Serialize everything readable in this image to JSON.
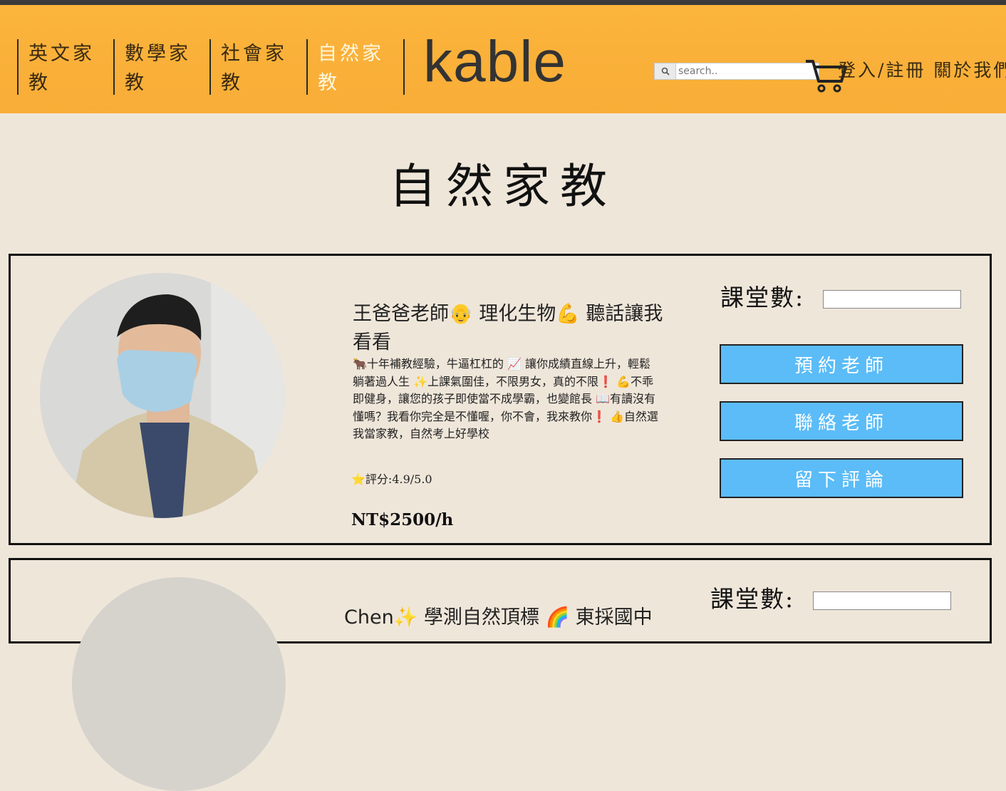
{
  "nav": {
    "items": [
      {
        "label": "英文家教",
        "active": false
      },
      {
        "label": "數學家教",
        "active": false
      },
      {
        "label": "社會家教",
        "active": false
      },
      {
        "label": "自然家教",
        "active": true
      }
    ],
    "brand": "kable",
    "search_placeholder": "search..",
    "right_text": "登入/註冊 關於我們"
  },
  "page": {
    "title": "自然家教"
  },
  "teachers": [
    {
      "name": "王爸爸老師👴 理化生物💪 聽話讓我看看",
      "description": "🐂十年補教經驗，牛逼杠杠的 📈 讓你成績直線上升，輕鬆躺著過人生 ✨上課氣圍佳，不限男女，真的不限❗ 💪不乖即健身，讓您的孩子即使當不成學霸，也變館長 📖有讀沒有懂嗎？我看你完全是不懂喔，你不會，我來教你❗ 👍自然選我當家教，自然考上好學校",
      "rating": "⭐評分:4.9/5.0",
      "price": "NT$2500/h",
      "lesson_label": "課堂數:",
      "buttons": {
        "book": "預約老師",
        "contact": "聯絡老師",
        "review": "留下評論"
      }
    },
    {
      "name": "Chen✨ 學測自然頂標 🌈 東採國中",
      "lesson_label": "課堂數:"
    }
  ],
  "colors": {
    "header": "#f9b13a",
    "button": "#5bbcf7",
    "background": "#efe6da"
  },
  "icons": [
    "search-icon",
    "cart-icon"
  ]
}
